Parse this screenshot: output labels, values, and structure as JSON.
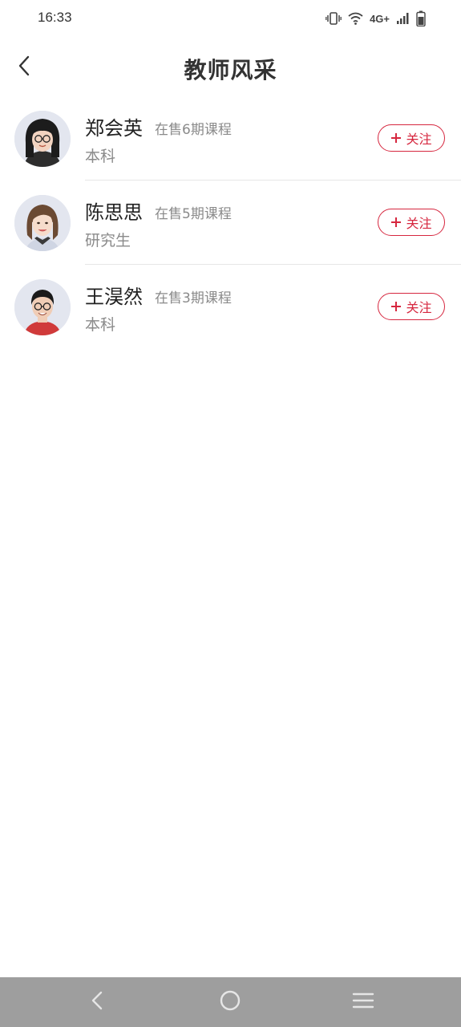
{
  "status_bar": {
    "time": "16:33",
    "network": "4G+",
    "icons": [
      "vibrate-icon",
      "wifi-icon",
      "signal-icon",
      "battery-icon"
    ]
  },
  "header": {
    "title": "教师风采",
    "back_icon": "chevron-left-icon"
  },
  "teachers": [
    {
      "name": "郑会英",
      "courses": "在售6期课程",
      "degree": "本科",
      "follow_label": "关注"
    },
    {
      "name": "陈思思",
      "courses": "在售5期课程",
      "degree": "研究生",
      "follow_label": "关注"
    },
    {
      "name": "王淏然",
      "courses": "在售3期课程",
      "degree": "本科",
      "follow_label": "关注"
    }
  ],
  "nav_bar": {
    "icons": [
      "nav-back-icon",
      "nav-home-icon",
      "nav-menu-icon"
    ]
  },
  "colors": {
    "accent": "#d6273f",
    "title_text": "#333333",
    "secondary_text": "#8a8a8a",
    "nav_bar_bg": "#9e9e9e"
  }
}
